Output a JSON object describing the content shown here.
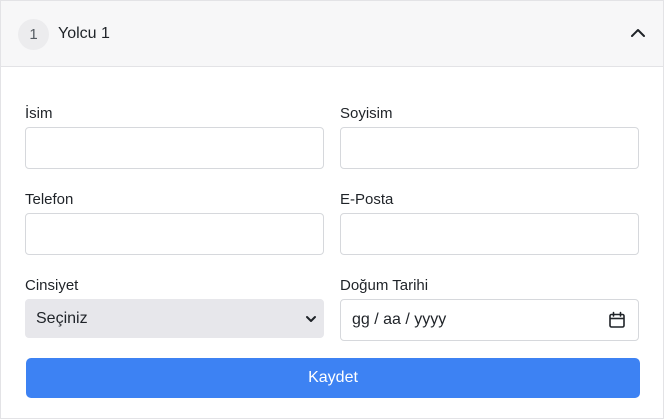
{
  "passenger": {
    "step_number": "1",
    "title": "Yolcu 1"
  },
  "form": {
    "first_name": {
      "label": "İsim",
      "value": ""
    },
    "last_name": {
      "label": "Soyisim",
      "value": ""
    },
    "phone": {
      "label": "Telefon",
      "value": ""
    },
    "email": {
      "label": "E-Posta",
      "value": ""
    },
    "gender": {
      "label": "Cinsiyet",
      "selected": "Seçiniz"
    },
    "birth_date": {
      "label": "Doğum Tarihi",
      "placeholder": "gg / aa / yyyy"
    }
  },
  "actions": {
    "save_label": "Kaydet"
  },
  "colors": {
    "primary": "#3d82f3",
    "header_bg": "#f7f7f8",
    "select_bg": "#e7e7eb"
  },
  "icons": {
    "collapse": "chevron-up-icon",
    "select_arrow": "chevron-down-icon",
    "date_picker": "calendar-icon"
  }
}
